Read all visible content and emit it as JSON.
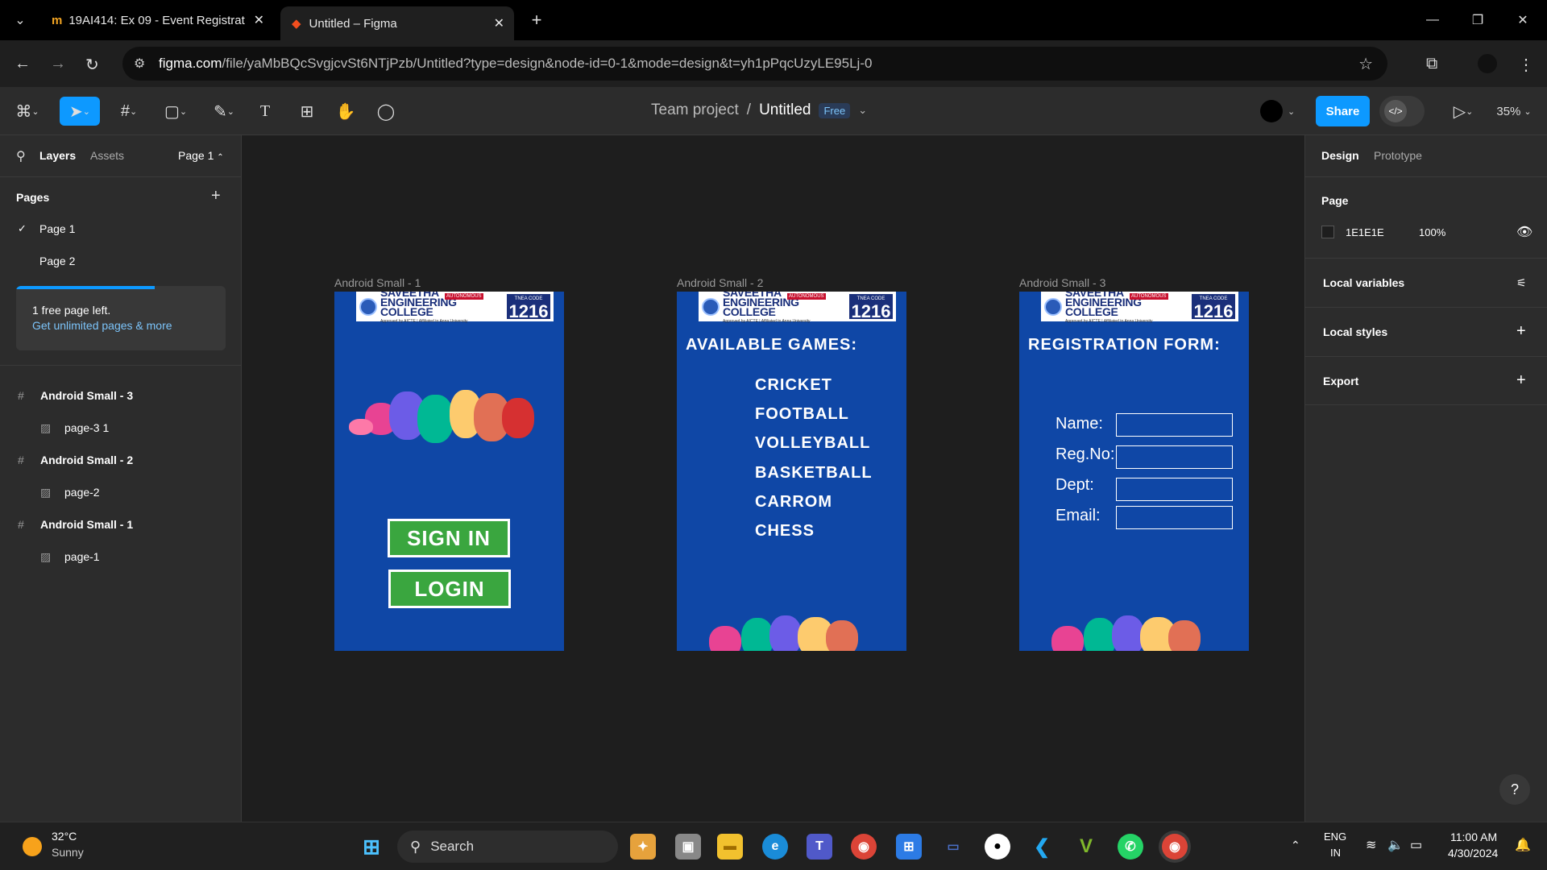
{
  "browser": {
    "tabs": [
      {
        "label": "19AI414: Ex 09 - Event Registrat",
        "close": "✕"
      },
      {
        "label": "Untitled – Figma",
        "close": "✕"
      }
    ],
    "new_tab": "+",
    "url_domain": "figma.com",
    "url_path": "/file/yaMbBQcSvgjcvSt6NTjPzb/Untitled?type=design&node-id=0-1&mode=design&t=yh1pPqcUzyLE95Lj-0"
  },
  "toolbar": {
    "team": "Team project",
    "separator": "/",
    "file": "Untitled",
    "plan_badge": "Free",
    "share": "Share",
    "zoom": "35%"
  },
  "left_panel": {
    "tab_layers": "Layers",
    "tab_assets": "Assets",
    "page_selector": "Page 1",
    "pages_header": "Pages",
    "pages": [
      "Page 1",
      "Page 2"
    ],
    "upsell_text": "1 free page left.",
    "upsell_link": "Get unlimited pages & more",
    "layers": [
      {
        "name": "Android Small - 3",
        "type": "frame"
      },
      {
        "name": "page-3 1",
        "type": "image"
      },
      {
        "name": "Android Small - 2",
        "type": "frame"
      },
      {
        "name": "page-2",
        "type": "image"
      },
      {
        "name": "Android Small - 1",
        "type": "frame"
      },
      {
        "name": "page-1",
        "type": "image"
      }
    ]
  },
  "right_panel": {
    "tab_design": "Design",
    "tab_prototype": "Prototype",
    "page_header": "Page",
    "page_color": "1E1E1E",
    "page_opacity": "100%",
    "local_variables": "Local variables",
    "local_styles": "Local styles",
    "export": "Export"
  },
  "canvas": {
    "frames": [
      {
        "label": "Android Small - 1",
        "sign_in": "SIGN IN",
        "login": "LOGIN"
      },
      {
        "label": "Android Small - 2",
        "title": "AVAILABLE GAMES:",
        "games": [
          "CRICKET",
          "FOOTBALL",
          "VOLLEYBALL",
          "BASKETBALL",
          "CARROM",
          "CHESS"
        ]
      },
      {
        "label": "Android Small - 3",
        "title": "REGISTRATION FORM:",
        "fields": [
          "Name:",
          "Reg.No:",
          "Dept:",
          "Email:"
        ]
      }
    ],
    "logo": {
      "name": "SAVEETHA ENGINEERING COLLEGE",
      "autonomous": "AUTONOMOUS",
      "sub": "Approved by AICTE | Affiliated to Anna University",
      "code_label": "TNEA CODE",
      "code": "1216"
    },
    "help": "?"
  },
  "taskbar": {
    "temp": "32°C",
    "weather": "Sunny",
    "search": "Search",
    "lang1": "ENG",
    "lang2": "IN",
    "time": "11:00 AM",
    "date": "4/30/2024"
  }
}
